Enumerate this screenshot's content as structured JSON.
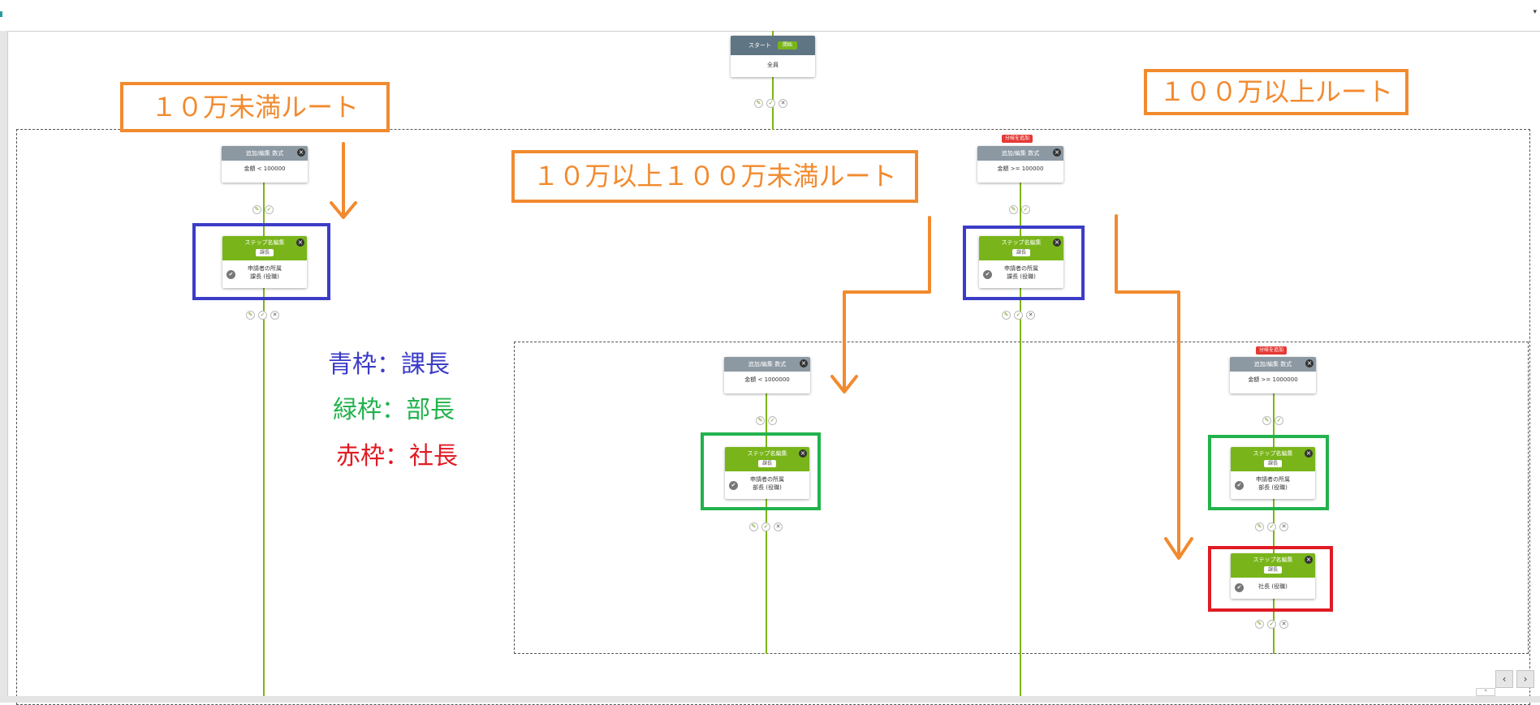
{
  "toolbar": {
    "caret": "▾"
  },
  "nodes": {
    "start": {
      "title": "スタート",
      "badge": "開始",
      "body": "全員"
    },
    "cond_under_10man": {
      "title": "追加/編集 数式",
      "body": "金額 < 100000"
    },
    "cond_over_10man": {
      "flag": "分岐を追加",
      "title": "追加/編集 数式",
      "body": "金額 >= 100000"
    },
    "cond_under_100man": {
      "title": "追加/編集 数式",
      "body": "金額 < 1000000"
    },
    "cond_over_100man": {
      "flag": "分岐を追加",
      "title": "追加/編集 数式",
      "body": "金額 >= 1000000"
    },
    "step_kacho_left": {
      "title": "ステップ名編集",
      "pill": "課長",
      "line1": "申請者の所属",
      "line2": "課長 (役職)"
    },
    "step_kacho_right": {
      "title": "ステップ名編集",
      "pill": "課長",
      "line1": "申請者の所属",
      "line2": "課長 (役職)"
    },
    "step_bucho_mid": {
      "title": "ステップ名編集",
      "pill": "課長",
      "line1": "申請者の所属",
      "line2": "部長 (役職)"
    },
    "step_bucho_right": {
      "title": "ステップ名編集",
      "pill": "課長",
      "line1": "申請者の所属",
      "line2": "部長 (役職)"
    },
    "step_shacho": {
      "title": "ステップ名編集",
      "pill": "課長",
      "line1": "社長 (役職)",
      "line2": ""
    }
  },
  "icons": {
    "close": "×",
    "check": "✔",
    "edit": "✎",
    "ok": "✓",
    "del": "✕"
  },
  "annotations": {
    "route_under_10man": "１０万未満ルート",
    "route_10man_100man": "１０万以上１００万未満ルート",
    "route_over_100man": "１００万以上ルート"
  },
  "legend": {
    "blue": "青枠：課長",
    "green": "緑枠：部長",
    "red": "赤枠：社長"
  },
  "colors": {
    "annotation_orange": "#f28a2e",
    "legend_blue": "#3c3cc8",
    "legend_green": "#22b24c",
    "legend_red": "#e01b24",
    "flow_line": "#79b51a",
    "step_header": "#79b51a",
    "condition_header": "#8c99a3",
    "start_header": "#5f7583"
  },
  "nav": {
    "prev": "‹",
    "next": "›",
    "up": "⌃"
  }
}
